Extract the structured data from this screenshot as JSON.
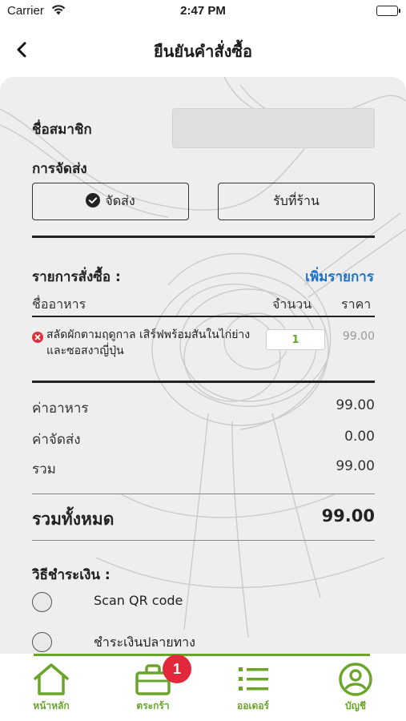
{
  "status_bar": {
    "carrier": "Carrier",
    "time": "2:47 PM"
  },
  "nav": {
    "title": "ยืนยันคำสั่งซื้อ"
  },
  "form": {
    "member_label": "ชื่อสมาชิก",
    "member_value": "",
    "delivery_label": "การจัดส่ง",
    "delivery_options": [
      {
        "label": "จัดส่ง",
        "selected": true
      },
      {
        "label": "รับที่ร้าน",
        "selected": false
      }
    ]
  },
  "order": {
    "section_title": "รายการสั่งซื้อ :",
    "add_item": "เพิ่มรายการ",
    "columns": {
      "name": "ชื่ออาหาร",
      "qty": "จำนวน",
      "price": "ราคา"
    },
    "items": [
      {
        "name": "สลัดผักตามฤดูกาล เสิร์ฟพร้อมสันในไก่ย่าง และซอสงาญี่ปุ่น",
        "qty": "1",
        "price": "99.00"
      }
    ]
  },
  "summary": {
    "food_label": "ค่าอาหาร",
    "food_value": "99.00",
    "shipping_label": "ค่าจัดส่ง",
    "shipping_value": "0.00",
    "subtotal_label": "รวม",
    "subtotal_value": "99.00",
    "total_label": "รวมทั้งหมด",
    "total_value": "99.00"
  },
  "payment": {
    "title": "วิธีชำระเงิน :",
    "options": [
      {
        "label": "Scan QR code",
        "selected": false
      },
      {
        "label": "ชำระเงินปลายทาง",
        "selected": false
      }
    ]
  },
  "tabbar": {
    "home": "หน้าหลัก",
    "cart": "ตระกร้า",
    "cart_badge": "1",
    "orders": "ออเดอร์",
    "account": "บัญชี"
  },
  "colors": {
    "accent": "#6aa52a",
    "link": "#1a73c8",
    "badge": "#e2283b"
  }
}
